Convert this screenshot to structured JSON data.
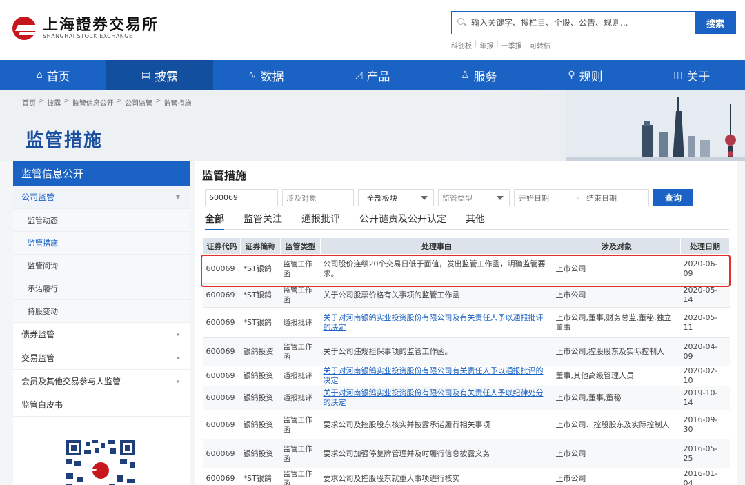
{
  "header": {
    "logo_cn": "上海證券交易所",
    "logo_en": "SHANGHAI STOCK EXCHANGE",
    "search_placeholder": "输入关键字、搜栏目、个股、公告、规则...",
    "search_button": "搜索",
    "hot_links": [
      "科创板",
      "年报",
      "一季报",
      "可转债"
    ]
  },
  "nav": {
    "items": [
      {
        "label": "首页",
        "icon": "home-icon",
        "glyph": "⌂"
      },
      {
        "label": "披露",
        "icon": "document-icon",
        "glyph": "▤"
      },
      {
        "label": "数据",
        "icon": "chart-icon",
        "glyph": "∿"
      },
      {
        "label": "产品",
        "icon": "product-icon",
        "glyph": "◿"
      },
      {
        "label": "服务",
        "icon": "service-icon",
        "glyph": "♙"
      },
      {
        "label": "规则",
        "icon": "rule-icon",
        "glyph": "⚲"
      },
      {
        "label": "关于",
        "icon": "about-icon",
        "glyph": "◫"
      }
    ],
    "active_index": 1
  },
  "breadcrumb": [
    "首页",
    "披露",
    "监管信息公开",
    "公司监管",
    "监管措施"
  ],
  "banner": {
    "title": "监管措施"
  },
  "sidebar": {
    "title": "监管信息公开",
    "group_open": "公司监管",
    "sub_items": [
      "监管动态",
      "监管措施",
      "监管问询",
      "承诺履行",
      "持股变动"
    ],
    "groups": [
      "债券监管",
      "交易监管",
      "会员及其他交易参与人监管",
      "监管白皮书"
    ]
  },
  "main": {
    "title": "监管措施",
    "filters": {
      "code_value": "600069",
      "object_placeholder": "涉及对象",
      "board_value": "全部板块",
      "type_placeholder": "监管类型",
      "start_placeholder": "开始日期",
      "end_placeholder": "结束日期",
      "dash": "-",
      "query_button": "查询"
    },
    "tabs": [
      "全部",
      "监管关注",
      "通报批评",
      "公开谴责及公开认定",
      "其他"
    ],
    "table": {
      "headers": [
        "证券代码",
        "证券简称",
        "监管类型",
        "处理事由",
        "涉及对象",
        "处理日期"
      ],
      "rows": [
        {
          "code": "600069",
          "name": "*ST银鸽",
          "type": "监管工作函",
          "reason": "公司股价连续20个交易日低于面值，发出监管工作函，明确监管要求。",
          "object": "上市公司",
          "date": "2020-06-09",
          "link": false
        },
        {
          "code": "600069",
          "name": "*ST银鸽",
          "type": "监管工作函",
          "reason": "关于公司股票价格有关事项的监管工作函",
          "object": "上市公司",
          "date": "2020-05-14",
          "link": false
        },
        {
          "code": "600069",
          "name": "*ST银鸽",
          "type": "通报批评",
          "reason": "关于对河南银鸽实业投资股份有限公司及有关责任人予以通报批评的决定",
          "object": "上市公司,董事,财务总监,董秘,独立董事",
          "date": "2020-05-11",
          "link": true
        },
        {
          "code": "600069",
          "name": "银鸽投资",
          "type": "监管工作函",
          "reason": "关于公司违规担保事项的监管工作函。",
          "object": "上市公司,控股股东及实际控制人",
          "date": "2020-04-09",
          "link": false
        },
        {
          "code": "600069",
          "name": "银鸽投资",
          "type": "通报批评",
          "reason": "关于对河南银鸽实业投资股份有限公司有关责任人予以通报批评的决定",
          "object": "董事,其他高级管理人员",
          "date": "2020-02-10",
          "link": true
        },
        {
          "code": "600069",
          "name": "银鸽投资",
          "type": "通报批评",
          "reason": "关于对河南银鸽实业投资股份有限公司及有关责任人予以纪律处分的决定",
          "object": "上市公司,董事,董秘",
          "date": "2019-10-14",
          "link": true
        },
        {
          "code": "600069",
          "name": "银鸽投资",
          "type": "监管工作函",
          "reason": "要求公司及控股股东核实并披露承诺履行相关事项",
          "object": "上市公司、控股股东及实际控制人",
          "date": "2016-09-30",
          "link": false
        },
        {
          "code": "600069",
          "name": "银鸽投资",
          "type": "监管工作函",
          "reason": "要求公司加强停复牌管理并及时履行信息披露义务",
          "object": "上市公司",
          "date": "2016-05-25",
          "link": false
        },
        {
          "code": "600069",
          "name": "*ST银鸽",
          "type": "监管工作函",
          "reason": "要求公司及控股股东就重大事项进行核实",
          "object": "上市公司",
          "date": "2016-01-04",
          "link": false
        }
      ]
    }
  },
  "colors": {
    "brand_blue": "#1a62c3",
    "logo_red": "#c8161d",
    "highlight_red": "#e03028"
  }
}
